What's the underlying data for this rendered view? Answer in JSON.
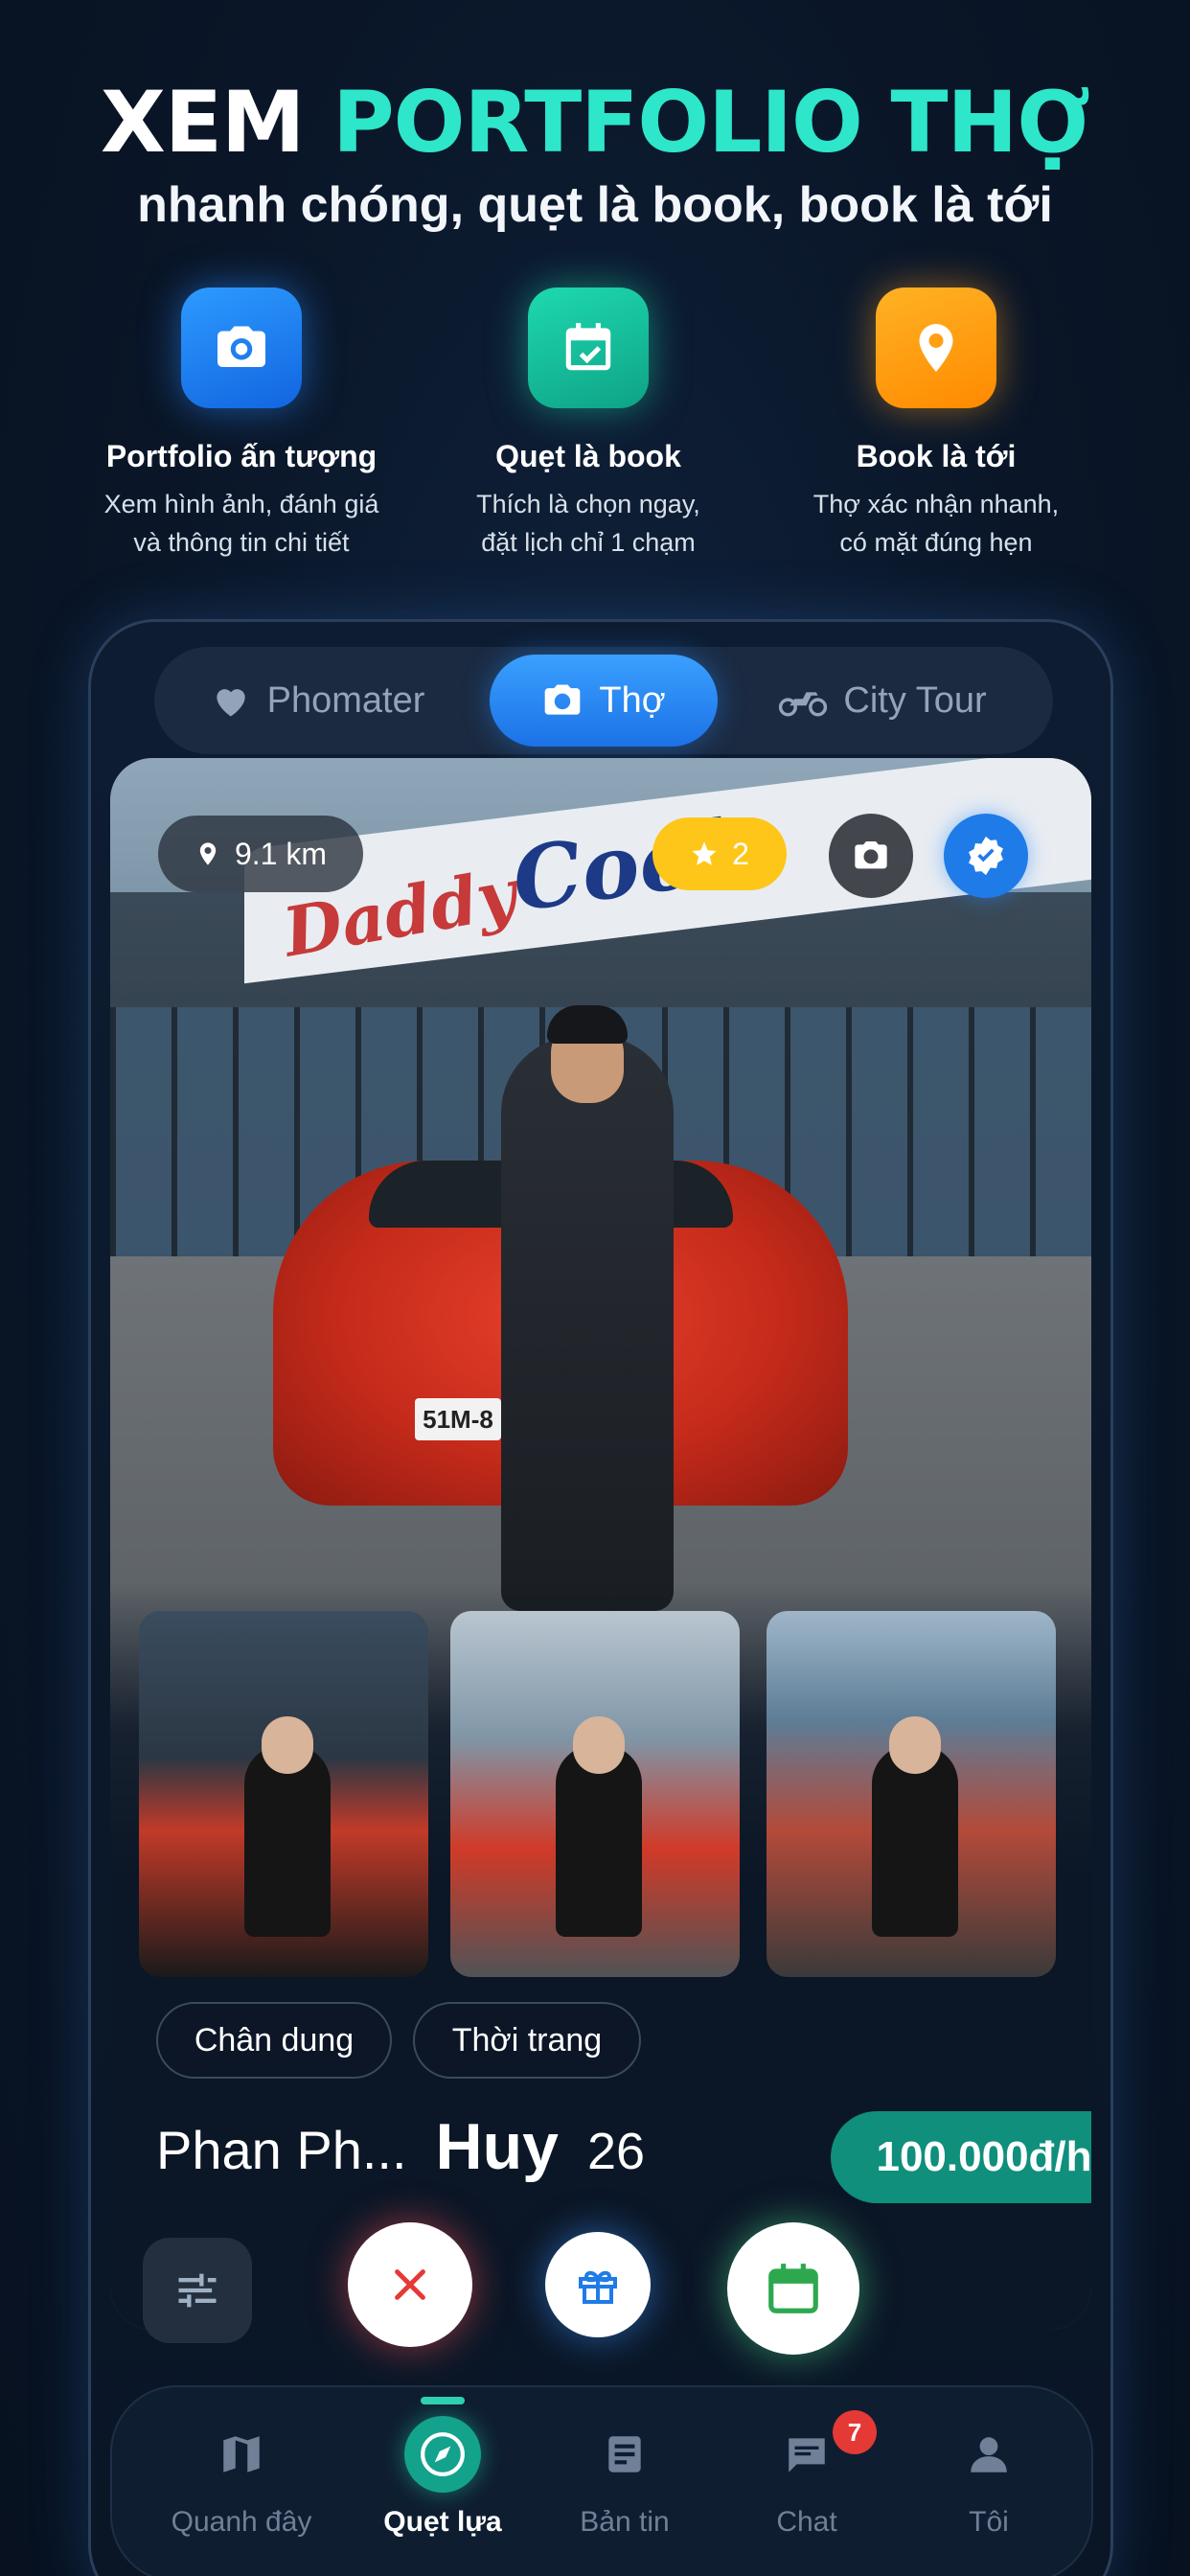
{
  "hero": {
    "title_part1": "XEM",
    "title_part2": "PORTFOLIO THỢ",
    "subtitle": "nhanh chóng, quẹt là book, book là tới"
  },
  "features": [
    {
      "icon": "camera-icon",
      "title": "Portfolio ấn tượng",
      "desc_line1": "Xem hình ảnh, đánh giá",
      "desc_line2": "và thông tin chi tiết"
    },
    {
      "icon": "calendar-check-icon",
      "title": "Quẹt là book",
      "desc_line1": "Thích là chọn ngay,",
      "desc_line2": "đặt lịch chỉ 1 chạm"
    },
    {
      "icon": "location-pin-icon",
      "title": "Book là tới",
      "desc_line1": "Thợ xác nhận nhanh,",
      "desc_line2": "có mặt đúng hẹn"
    }
  ],
  "segments": [
    {
      "label": "Phomater",
      "icon": "heart-icon",
      "active": false
    },
    {
      "label": "Thợ",
      "icon": "camera-icon",
      "active": true
    },
    {
      "label": "City Tour",
      "icon": "motorbike-icon",
      "active": false
    }
  ],
  "card": {
    "distance": "9.1 km",
    "rating": "2",
    "tags": [
      "Chân dung",
      "Thời trang"
    ],
    "name_first": "Phan Ph...",
    "name_last": "Huy",
    "age": "26",
    "price": "100.000đ/h",
    "photo_text": {
      "sign_top": "Daddy",
      "sign_main": "Cool",
      "plate": "51M-8"
    }
  },
  "tabbar": {
    "items": [
      {
        "label": "Quanh đây",
        "icon": "map-icon"
      },
      {
        "label": "Quẹt lựa",
        "icon": "compass-icon",
        "active": true
      },
      {
        "label": "Bản tin",
        "icon": "news-icon"
      },
      {
        "label": "Chat",
        "icon": "chat-icon",
        "badge": "7"
      },
      {
        "label": "Tôi",
        "icon": "user-icon"
      }
    ]
  },
  "colors": {
    "accent": "#2ee6c9",
    "primary": "#1f7be8",
    "price": "#0f8f7c",
    "rating": "#ffc61a",
    "background": "#0a1628"
  }
}
